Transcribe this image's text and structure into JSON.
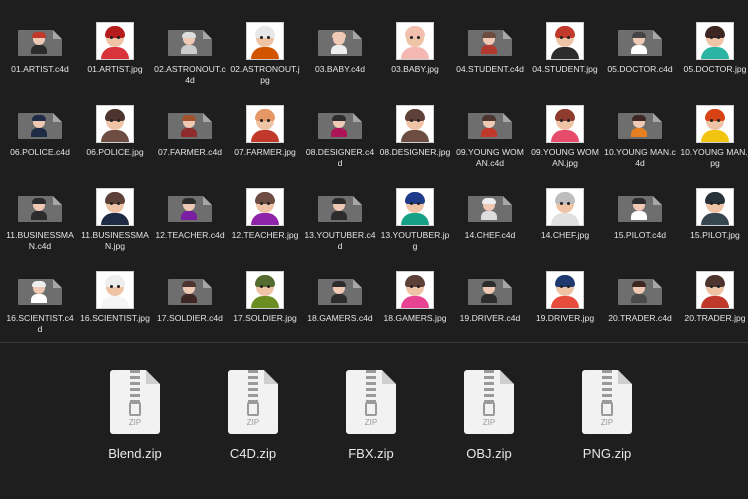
{
  "colors": {
    "background": "#1e1e1e",
    "c4d_icon": "#6e6e6e",
    "label": "#e4e4e4"
  },
  "files": [
    {
      "label": "01.ARTIST.c4d",
      "kind": "c4d",
      "hair": "#c0392b",
      "body": "#2b2b2b"
    },
    {
      "label": "01.ARTIST.jpg",
      "kind": "jpg",
      "hair": "#b71c1c",
      "body": "#d9343b"
    },
    {
      "label": "02.ASTRONOUT.c4d",
      "kind": "c4d",
      "hair": "#dddddd",
      "body": "#cccccc"
    },
    {
      "label": "02.ASTRONOUT.jpg",
      "kind": "jpg",
      "hair": "#e8e8e8",
      "body": "#d35400"
    },
    {
      "label": "03.BABY.c4d",
      "kind": "c4d",
      "hair": "#efc9b4",
      "body": "#eeeeee"
    },
    {
      "label": "03.BABY.jpg",
      "kind": "jpg",
      "hair": "#f2c1ad",
      "body": "#f5b7b1"
    },
    {
      "label": "04.STUDENT.c4d",
      "kind": "c4d",
      "hair": "#6d4c41",
      "body": "#b03a2e"
    },
    {
      "label": "04.STUDENT.jpg",
      "kind": "jpg",
      "hair": "#c0392b",
      "body": "#2c2c2c"
    },
    {
      "label": "05.DOCTOR.c4d",
      "kind": "c4d",
      "hair": "#444444",
      "body": "#ffffff"
    },
    {
      "label": "05.DOCTOR.jpg",
      "kind": "jpg",
      "hair": "#3e2723",
      "body": "#2bb3a3"
    },
    {
      "label": "06.POLICE.c4d",
      "kind": "c4d",
      "hair": "#1f2a44",
      "body": "#1f2a44"
    },
    {
      "label": "06.POLICE.jpg",
      "kind": "jpg",
      "hair": "#4e342e",
      "body": "#6d4c41"
    },
    {
      "label": "07.FARMER.c4d",
      "kind": "c4d",
      "hair": "#a0522d",
      "body": "#8e2b2b"
    },
    {
      "label": "07.FARMER.jpg",
      "kind": "jpg",
      "hair": "#e59866",
      "body": "#c0392b"
    },
    {
      "label": "08.DESIGNER.c4d",
      "kind": "c4d",
      "hair": "#2c2c2c",
      "body": "#ad1457"
    },
    {
      "label": "08.DESIGNER.jpg",
      "kind": "jpg",
      "hair": "#5d4037",
      "body": "#6d4c41"
    },
    {
      "label": "09.YOUNG WOMAN.c4d",
      "kind": "c4d",
      "hair": "#4e342e",
      "body": "#c0392b"
    },
    {
      "label": "09.YOUNG WOMAN.jpg",
      "kind": "jpg",
      "hair": "#8e3b2e",
      "body": "#e74c6c"
    },
    {
      "label": "10.YOUNG MAN.c4d",
      "kind": "c4d",
      "hair": "#3e2723",
      "body": "#e67e22"
    },
    {
      "label": "10.YOUNG MAN.jpg",
      "kind": "jpg",
      "hair": "#d84315",
      "body": "#f1c40f"
    },
    {
      "label": "11.BUSINESSMAN.c4d",
      "kind": "c4d",
      "hair": "#2c2c2c",
      "body": "#2c2c2c"
    },
    {
      "label": "11.BUSINESSMAN.jpg",
      "kind": "jpg",
      "hair": "#5d4037",
      "body": "#1f2a44"
    },
    {
      "label": "12.TEACHER.c4d",
      "kind": "c4d",
      "hair": "#2c2c2c",
      "body": "#7b1fa2"
    },
    {
      "label": "12.TEACHER.jpg",
      "kind": "jpg",
      "hair": "#6d4c41",
      "body": "#8e24aa"
    },
    {
      "label": "13.YOUTUBER.c4d",
      "kind": "c4d",
      "hair": "#2c2c2c",
      "body": "#2c2c2c"
    },
    {
      "label": "13.YOUTUBER.jpg",
      "kind": "jpg",
      "hair": "#1e3a8a",
      "body": "#16a085"
    },
    {
      "label": "14.CHEF.c4d",
      "kind": "c4d",
      "hair": "#eeeeee",
      "body": "#dddddd"
    },
    {
      "label": "14.CHEF.jpg",
      "kind": "jpg",
      "hair": "#bdbdbd",
      "body": "#e0e0e0"
    },
    {
      "label": "15.PILOT.c4d",
      "kind": "c4d",
      "hair": "#2c2c2c",
      "body": "#ffffff"
    },
    {
      "label": "15.PILOT.jpg",
      "kind": "jpg",
      "hair": "#263238",
      "body": "#37474f"
    },
    {
      "label": "16.SCIENTIST.c4d",
      "kind": "c4d",
      "hair": "#eeeeee",
      "body": "#ffffff"
    },
    {
      "label": "16.SCIENTIST.jpg",
      "kind": "jpg",
      "hair": "#eeeeee",
      "body": "#f5f5f5"
    },
    {
      "label": "17.SOLDIER.c4d",
      "kind": "c4d",
      "hair": "#4e342e",
      "body": "#3e2723"
    },
    {
      "label": "17.SOLDIER.jpg",
      "kind": "jpg",
      "hair": "#556b2f",
      "body": "#6b8e23"
    },
    {
      "label": "18.GAMERS.c4d",
      "kind": "c4d",
      "hair": "#2c2c2c",
      "body": "#2c2c2c"
    },
    {
      "label": "18.GAMERS.jpg",
      "kind": "jpg",
      "hair": "#5d4037",
      "body": "#e84393"
    },
    {
      "label": "19.DRIVER.c4d",
      "kind": "c4d",
      "hair": "#2c2c2c",
      "body": "#2c2c2c"
    },
    {
      "label": "19.DRIVER.jpg",
      "kind": "jpg",
      "hair": "#1f3a6e",
      "body": "#e74c3c"
    },
    {
      "label": "20.TRADER.c4d",
      "kind": "c4d",
      "hair": "#3e2723",
      "body": "#4a4a4a"
    },
    {
      "label": "20.TRADER.jpg",
      "kind": "jpg",
      "hair": "#4e342e",
      "body": "#c0392b"
    }
  ],
  "archives": [
    {
      "name": "Blend.zip",
      "tag": "ZIP"
    },
    {
      "name": "C4D.zip",
      "tag": "ZIP"
    },
    {
      "name": "FBX.zip",
      "tag": "ZIP"
    },
    {
      "name": "OBJ.zip",
      "tag": "ZIP"
    },
    {
      "name": "PNG.zip",
      "tag": "ZIP"
    }
  ]
}
